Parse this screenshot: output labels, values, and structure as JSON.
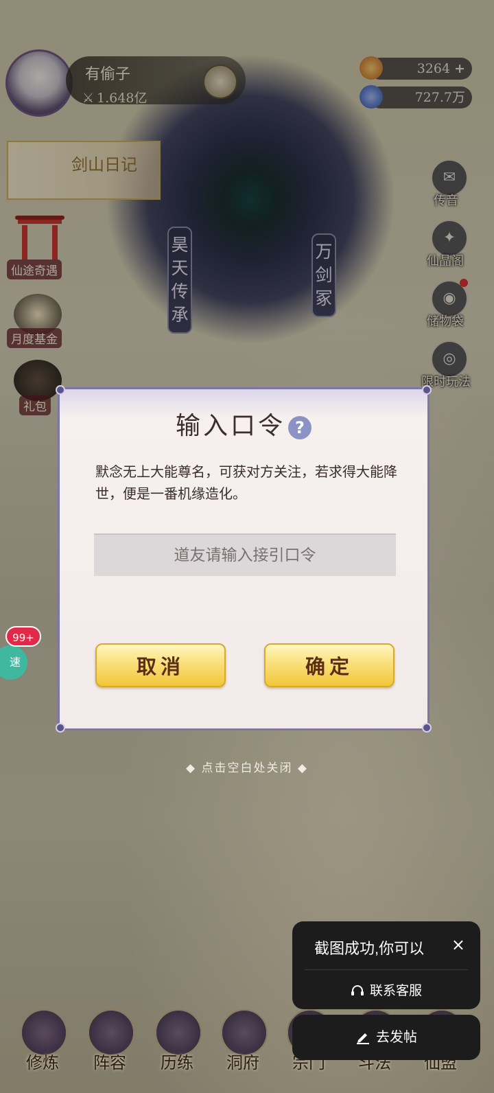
{
  "player": {
    "name": "有偷子",
    "power": "1.648亿"
  },
  "resources": [
    {
      "value": "3264",
      "plus": "+",
      "icon": "gold-ingot-icon",
      "color": "#e08a2a"
    },
    {
      "value": "727.7万",
      "icon": "spirit-stone-icon",
      "color": "#4a7ad8"
    }
  ],
  "left_events": {
    "diary": "剑山日记",
    "items": [
      "仙途奇遇",
      "月度基金",
      "礼包"
    ]
  },
  "pillars": [
    "昊天传承",
    "万剑冢"
  ],
  "right_menu": [
    "传音",
    "仙晶阁",
    "储物袋",
    "限时玩法"
  ],
  "badges": {
    "count": "99+",
    "speed": "速"
  },
  "dialog": {
    "title": "输入口令",
    "help": "?",
    "description": "默念无上大能尊名，可获对方关注，若求得大能降世，便是一番机缘造化。",
    "input_placeholder": "道友请输入接引口令",
    "cancel_label": "取消",
    "confirm_label": "确定"
  },
  "close_hint": "点击空白处关闭",
  "toast": {
    "message": "截图成功,你可以",
    "close": "×",
    "customer_service": "联系客服",
    "post": "去发帖"
  },
  "bottom_nav": [
    "修炼",
    "阵容",
    "历练",
    "洞府",
    "宗门",
    "斗法",
    "仙盟"
  ]
}
